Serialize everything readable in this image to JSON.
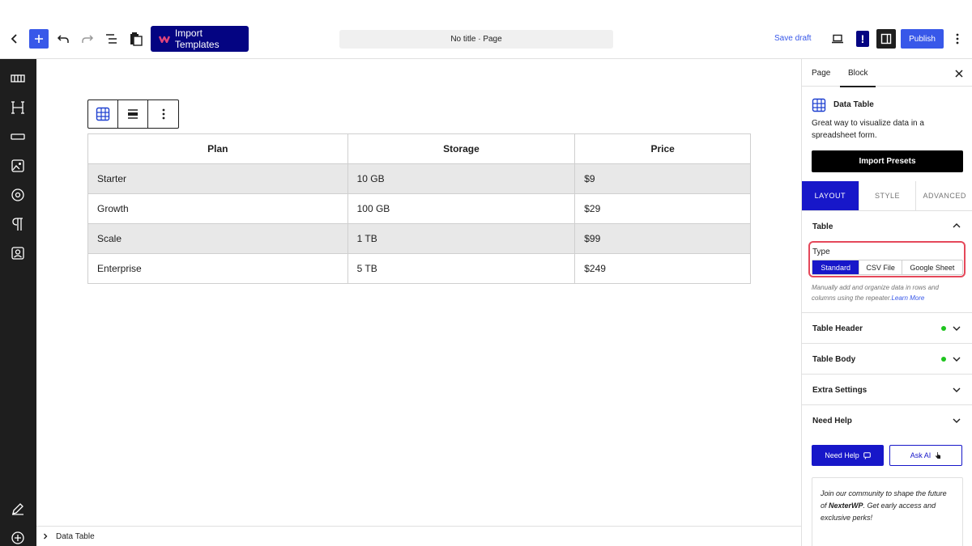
{
  "topbar": {
    "import_templates_label": "Import Templates",
    "document_title": "No title · Page",
    "save_draft_label": "Save draft",
    "notice_label": "!",
    "publish_label": "Publish"
  },
  "block_toolbar": {
    "icons": [
      "table-icon",
      "align-icon",
      "more-options-icon"
    ]
  },
  "table": {
    "headers": [
      "Plan",
      "Storage",
      "Price"
    ],
    "rows": [
      [
        "Starter",
        "10 GB",
        "$9"
      ],
      [
        "Growth",
        "100 GB",
        "$29"
      ],
      [
        "Scale",
        "1 TB",
        "$99"
      ],
      [
        "Enterprise",
        "5 TB",
        "$249"
      ]
    ]
  },
  "breadcrumb": {
    "label": "Data Table"
  },
  "panel": {
    "tabs": [
      "Page",
      "Block"
    ],
    "active_tab": "Block",
    "block_title": "Data Table",
    "block_description": "Great way to visualize data in a spreadsheet form.",
    "import_presets_label": "Import Presets",
    "settings_tabs": [
      "LAYOUT",
      "STYLE",
      "ADVANCED"
    ],
    "active_settings_tab": "LAYOUT",
    "table_section_title": "Table",
    "type_label": "Type",
    "type_options": [
      "Standard",
      "CSV File",
      "Google Sheet"
    ],
    "type_selected": "Standard",
    "type_help": "Manually add and organize data in rows and columns using the repeater.",
    "learn_more_label": "Learn More",
    "sections": [
      "Table Header",
      "Table Body",
      "Extra Settings",
      "Need Help"
    ],
    "need_help_label": "Need Help",
    "ask_ai_label": "Ask AI",
    "community_prefix": "Join our community to shape the future of ",
    "community_brand": "NexterWP",
    "community_suffix": ". Get early access and exclusive perks!"
  },
  "colors": {
    "accent": "#3858e9",
    "brand_dark": "#040482",
    "tab_active": "#1717c9",
    "highlight_border": "#e5485a",
    "status_dot": "#1ec41e"
  }
}
